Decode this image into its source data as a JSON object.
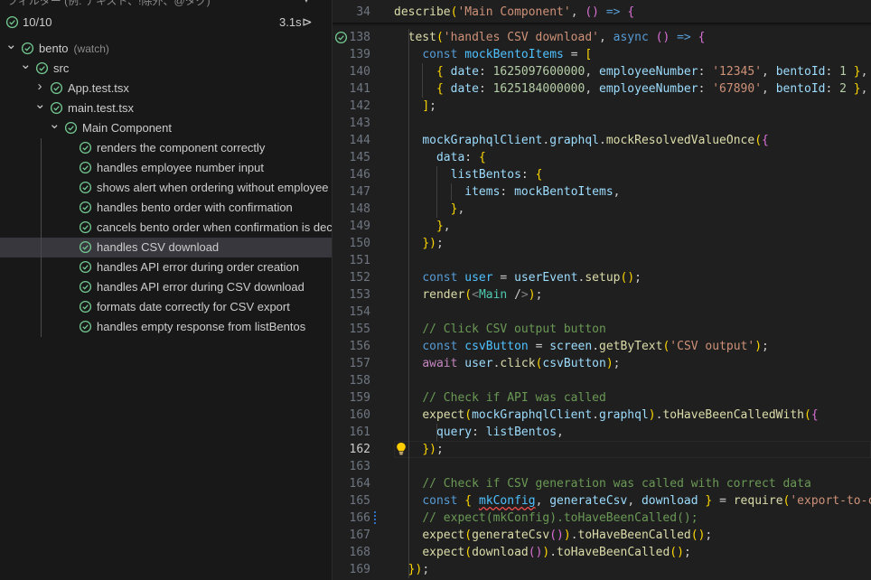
{
  "explorer": {
    "filter_text": "フィルター (例: テキスト、!除外、@タグ)",
    "summary": {
      "count": "10/10",
      "time": "3.1s"
    },
    "tree": [
      {
        "label": "bento",
        "sub": "(watch)",
        "depth": 0,
        "chevron": "open"
      },
      {
        "label": "src",
        "depth": 1,
        "chevron": "open"
      },
      {
        "label": "App.test.tsx",
        "depth": 2,
        "chevron": "closed"
      },
      {
        "label": "main.test.tsx",
        "depth": 2,
        "chevron": "open"
      },
      {
        "label": "Main Component",
        "depth": 3,
        "chevron": "open"
      },
      {
        "label": "renders the component correctly",
        "depth": 4
      },
      {
        "label": "handles employee number input",
        "depth": 4
      },
      {
        "label": "shows alert when ordering without employee nu...",
        "depth": 4
      },
      {
        "label": "handles bento order with confirmation",
        "depth": 4
      },
      {
        "label": "cancels bento order when confirmation is declined",
        "depth": 4
      },
      {
        "label": "handles CSV download",
        "depth": 4,
        "selected": true
      },
      {
        "label": "handles API error during order creation",
        "depth": 4
      },
      {
        "label": "handles API error during CSV download",
        "depth": 4
      },
      {
        "label": "formats date correctly for CSV export",
        "depth": 4
      },
      {
        "label": "handles empty response from listBentos",
        "depth": 4
      }
    ],
    "pass_color": "#73c991"
  },
  "editor": {
    "sticky_line": {
      "n": "34",
      "text": "describe('Main Component', () => {"
    },
    "active_line": "162",
    "lines": [
      {
        "n": "138",
        "gutter": "pass",
        "text": "  test('handles CSV download', async () => {"
      },
      {
        "n": "139",
        "text": "    const mockBentoItems = ["
      },
      {
        "n": "140",
        "text": "      { date: 1625097600000, employeeNumber: '12345', bentoId: 1 },"
      },
      {
        "n": "141",
        "text": "      { date: 1625184000000, employeeNumber: '67890', bentoId: 2 },"
      },
      {
        "n": "142",
        "text": "    ];"
      },
      {
        "n": "143",
        "text": ""
      },
      {
        "n": "144",
        "text": "    mockGraphqlClient.graphql.mockResolvedValueOnce({"
      },
      {
        "n": "145",
        "text": "      data: {"
      },
      {
        "n": "146",
        "text": "        listBentos: {"
      },
      {
        "n": "147",
        "text": "          items: mockBentoItems,"
      },
      {
        "n": "148",
        "text": "        },"
      },
      {
        "n": "149",
        "text": "      },"
      },
      {
        "n": "150",
        "text": "    });"
      },
      {
        "n": "151",
        "text": ""
      },
      {
        "n": "152",
        "text": "    const user = userEvent.setup();"
      },
      {
        "n": "153",
        "text": "    render(<Main />);"
      },
      {
        "n": "154",
        "text": ""
      },
      {
        "n": "155",
        "text": "    // Click CSV output button"
      },
      {
        "n": "156",
        "text": "    const csvButton = screen.getByText('CSV output');"
      },
      {
        "n": "157",
        "text": "    await user.click(csvButton);"
      },
      {
        "n": "158",
        "text": ""
      },
      {
        "n": "159",
        "text": "    // Check if API was called"
      },
      {
        "n": "160",
        "text": "    expect(mockGraphqlClient.graphql).toHaveBeenCalledWith({"
      },
      {
        "n": "161",
        "text": "      query: listBentos,"
      },
      {
        "n": "162",
        "gutter": "bulb",
        "text": "    });"
      },
      {
        "n": "163",
        "text": ""
      },
      {
        "n": "164",
        "text": "    // Check if CSV generation was called with correct data"
      },
      {
        "n": "165",
        "text": "    const { mkConfig, generateCsv, download } = require('export-to-csv');"
      },
      {
        "n": "166",
        "gutter": "modified",
        "text": "    // expect(mkConfig).toHaveBeenCalled();"
      },
      {
        "n": "167",
        "text": "    expect(generateCsv()).toHaveBeenCalled();"
      },
      {
        "n": "168",
        "text": "    expect(download()).toHaveBeenCalled();"
      },
      {
        "n": "169",
        "text": "  });"
      }
    ]
  }
}
